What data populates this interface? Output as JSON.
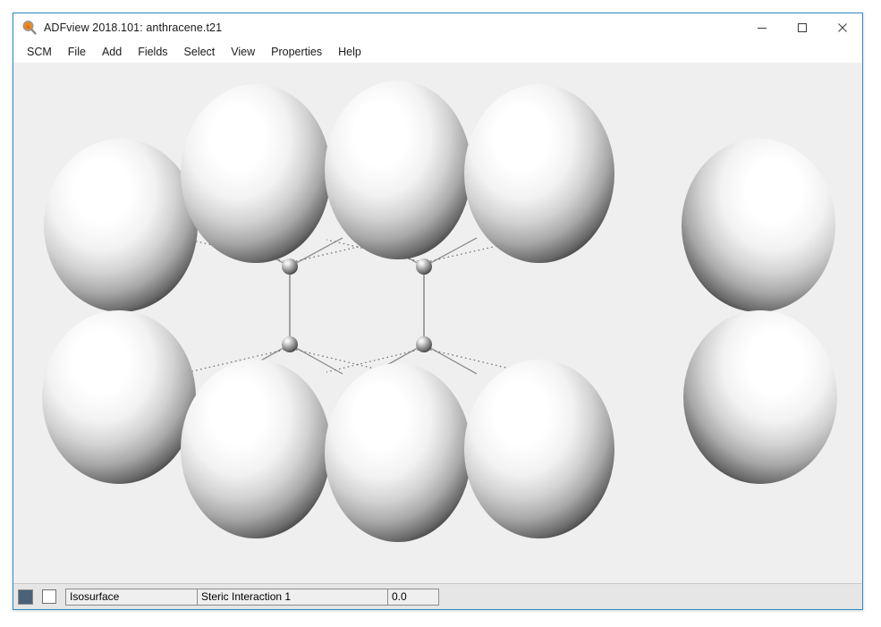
{
  "window": {
    "title": "ADFview 2018.101: anthracene.t21",
    "icon": "magnifier-icon",
    "border_color": "#2e8bc7",
    "controls": {
      "minimize": "minimize-icon",
      "maximize": "maximize-icon",
      "close": "close-icon"
    }
  },
  "menu": {
    "items": [
      {
        "label": "SCM"
      },
      {
        "label": "File"
      },
      {
        "label": "Add"
      },
      {
        "label": "Fields"
      },
      {
        "label": "Select"
      },
      {
        "label": "View"
      },
      {
        "label": "Properties"
      },
      {
        "label": "Help"
      }
    ]
  },
  "viewport": {
    "background_color": "#efefef",
    "molecule": "anthracene",
    "representation": "isosurface-with-ball-and-stick"
  },
  "status_bar": {
    "color_swatch": "#4a6278",
    "visibility_checked": false,
    "field_type": "Isosurface",
    "field_name": "Steric Interaction 1",
    "field_value": "0.0"
  }
}
